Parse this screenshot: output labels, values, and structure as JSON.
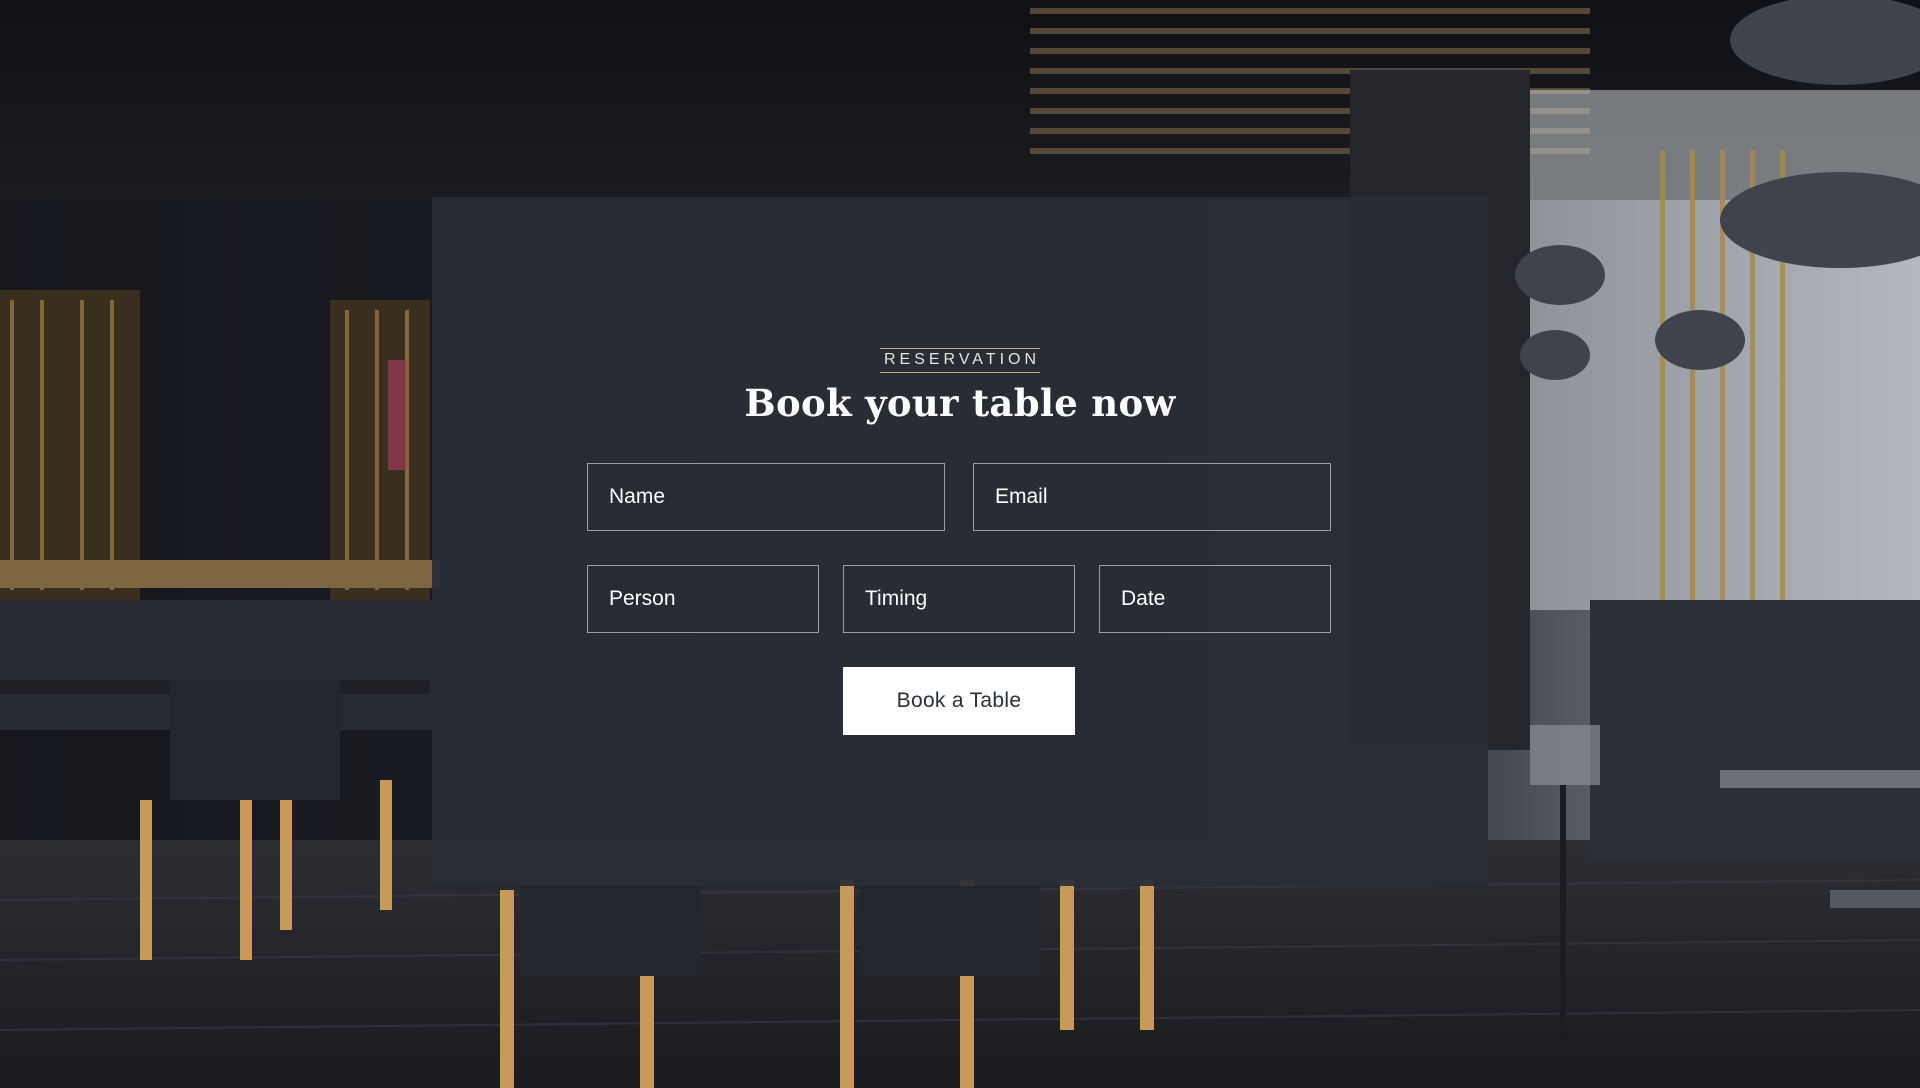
{
  "reservation": {
    "eyebrow": "RESERVATION",
    "title": "Book your table now",
    "fields": {
      "name": {
        "placeholder": "Name",
        "value": ""
      },
      "email": {
        "placeholder": "Email",
        "value": ""
      },
      "person": {
        "placeholder": "Person",
        "value": ""
      },
      "timing": {
        "placeholder": "Timing",
        "value": ""
      },
      "date": {
        "placeholder": "Date",
        "value": ""
      }
    },
    "submit_label": "Book a Table"
  },
  "colors": {
    "panel": "#292d36",
    "accent_rule": "#c9a96a",
    "text": "#ffffff",
    "button_bg": "#ffffff",
    "button_text": "#2b2f38"
  }
}
